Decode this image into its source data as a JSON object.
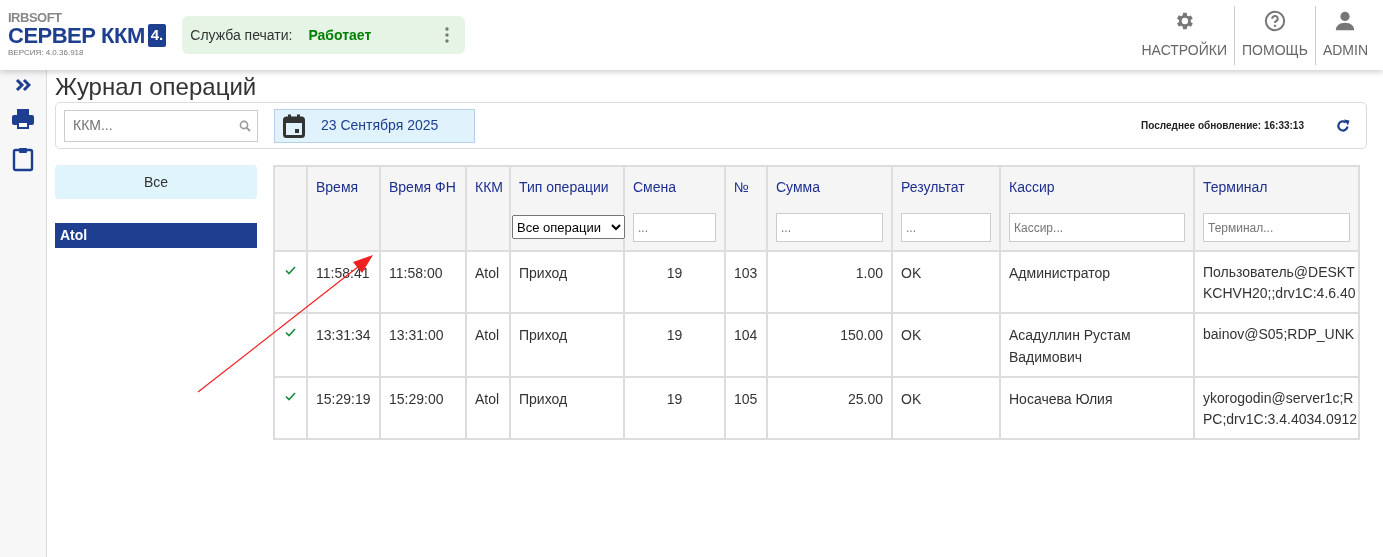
{
  "brand": {
    "company": "IRBSOFT",
    "product": "СЕРВЕР ККМ",
    "badge": "4.",
    "version": "ВЕРСИЯ: 4.0.36.918"
  },
  "service": {
    "label": "Служба печати:",
    "status": "Работает"
  },
  "top_menu": [
    {
      "label": "НАСТРОЙКИ"
    },
    {
      "label": "ПОМОЩЬ"
    },
    {
      "label": "ADMIN"
    }
  ],
  "page_title": "Журнал операций",
  "toolbar": {
    "search": {
      "placeholder": "ККМ..."
    },
    "date": "23 Сентября 2025",
    "last_update": "Последнее обновление: 16:33:13"
  },
  "device_filter": {
    "all_label": "Все",
    "devices": [
      {
        "name": "Atol",
        "selected": true
      }
    ]
  },
  "table": {
    "columns": [
      {
        "title": "Время"
      },
      {
        "title": "Время ФН"
      },
      {
        "title": "ККМ"
      },
      {
        "title": "Тип операции",
        "filter": {
          "kind": "select",
          "value": "Все операции"
        }
      },
      {
        "title": "Смена",
        "filter": {
          "kind": "input",
          "placeholder": "..."
        }
      },
      {
        "title": "№"
      },
      {
        "title": "Сумма",
        "filter": {
          "kind": "input",
          "placeholder": "..."
        }
      },
      {
        "title": "Результат",
        "filter": {
          "kind": "input",
          "placeholder": "..."
        }
      },
      {
        "title": "Кассир",
        "filter": {
          "kind": "input",
          "placeholder": "Кассир..."
        }
      },
      {
        "title": "Терминал",
        "filter": {
          "kind": "input",
          "placeholder": "Терминал..."
        }
      }
    ],
    "rows": [
      {
        "ok": true,
        "cells": [
          "11:58:41",
          "11:58:00",
          "Atol",
          "Приход",
          "19",
          "103",
          "1.00",
          "OK",
          "Администратор",
          "Пользователь@DESKT\nKCHVH20;;drv1C:4.6.40"
        ]
      },
      {
        "ok": true,
        "cells": [
          "13:31:34",
          "13:31:00",
          "Atol",
          "Приход",
          "19",
          "104",
          "150.00",
          "OK",
          "Асадуллин Рустам Вадимович",
          "bainov@S05;RDP_UNK"
        ]
      },
      {
        "ok": true,
        "cells": [
          "15:29:19",
          "15:29:00",
          "Atol",
          "Приход",
          "19",
          "105",
          "25.00",
          "OK",
          "Носачева Юлия",
          "ykorogodin@server1c;R\nPC;drv1C:3.4.4034.0912"
        ]
      }
    ]
  }
}
